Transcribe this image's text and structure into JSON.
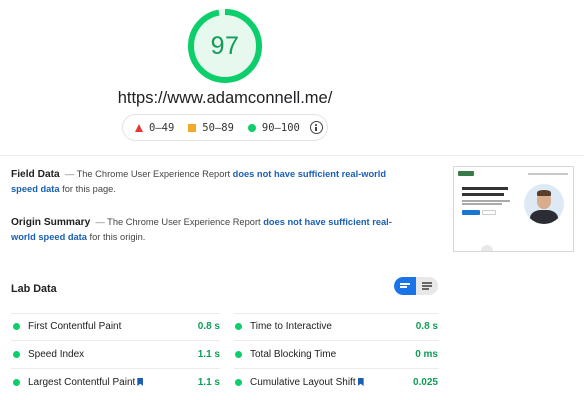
{
  "score": {
    "value": "97",
    "fraction": 0.97,
    "color": "#0cce6b"
  },
  "url": "https://www.adamconnell.me/",
  "legend": {
    "fail": "0–49",
    "average": "50–89",
    "pass": "90–100"
  },
  "field_data": {
    "heading": "Field Data",
    "dash": "—",
    "text_before": "The Chrome User Experience Report",
    "link": "does not have sufficient real-world speed data",
    "text_after": "for this page."
  },
  "origin_summary": {
    "heading": "Origin Summary",
    "dash": "—",
    "text_before": "The Chrome User Experience Report",
    "link": "does not have sufficient real-world speed data",
    "text_after": "for this origin."
  },
  "lab_data": {
    "heading": "Lab Data",
    "metrics": [
      {
        "label": "First Contentful Paint",
        "value": "0.8 s"
      },
      {
        "label": "Time to Interactive",
        "value": "0.8 s"
      },
      {
        "label": "Speed Index",
        "value": "1.1 s"
      },
      {
        "label": "Total Blocking Time",
        "value": "0 ms"
      },
      {
        "label": "Largest Contentful Paint",
        "value": "1.1 s"
      },
      {
        "label": "Cumulative Layout Shift",
        "value": "0.025"
      }
    ]
  },
  "colors": {
    "pass": "#0cce6b",
    "average": "#f9a825",
    "fail": "#e53935",
    "link": "#1a5fb4",
    "accent": "#1a73e8"
  }
}
